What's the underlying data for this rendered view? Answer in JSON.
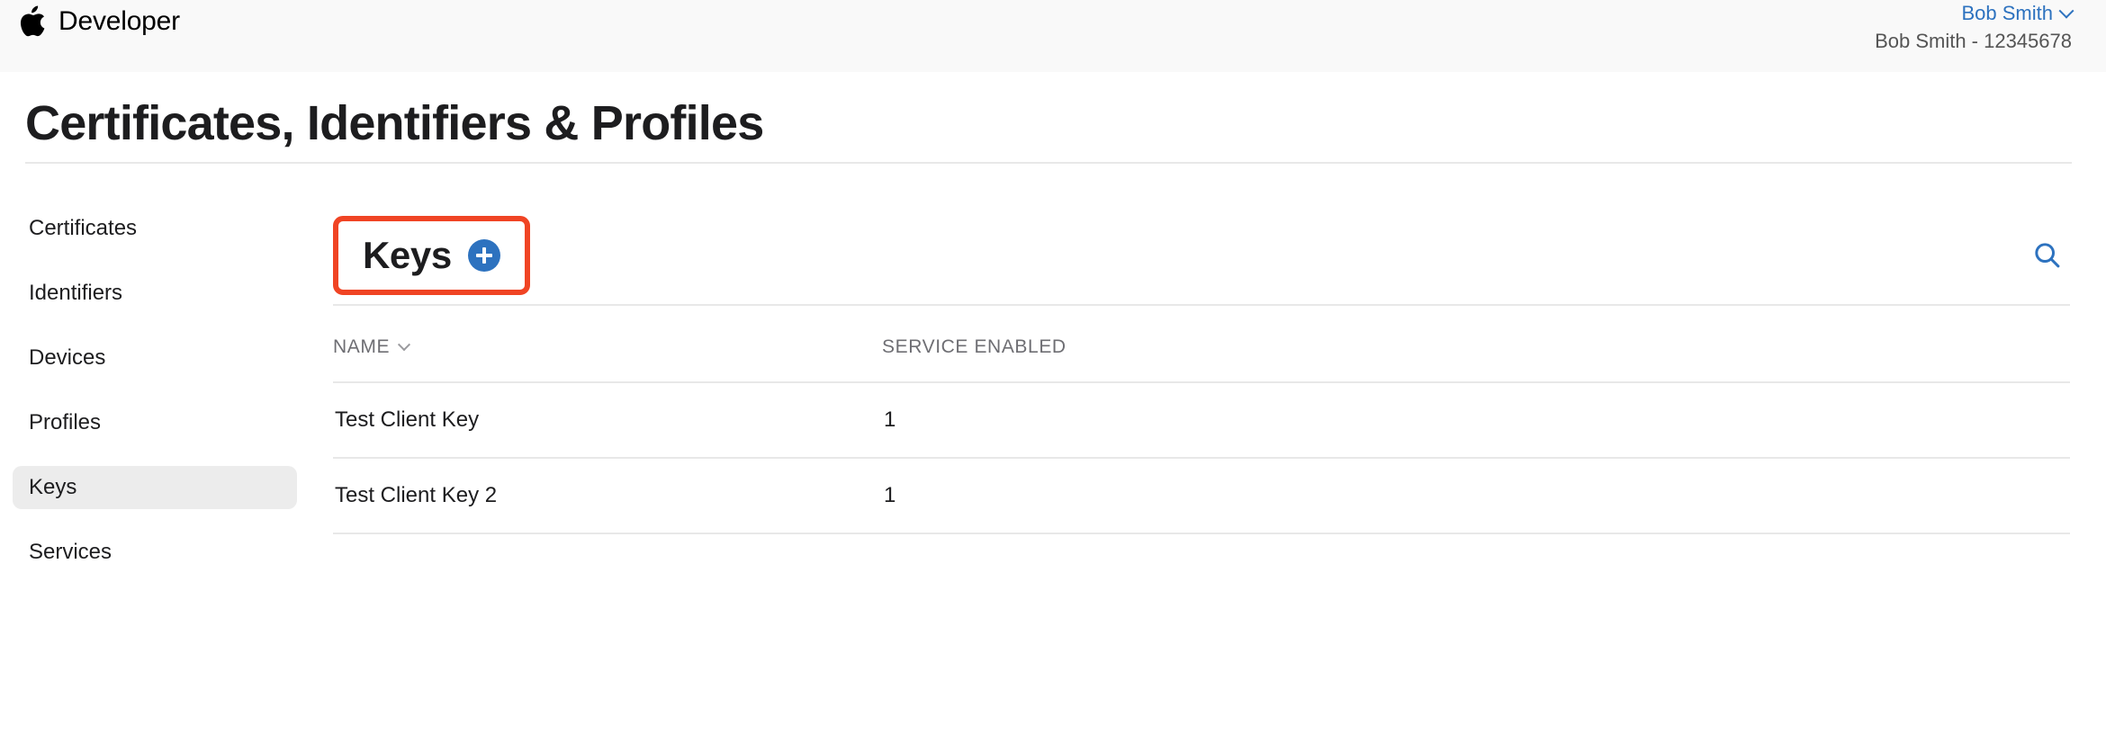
{
  "globalnav": {
    "logo_icon": "apple-logo-icon",
    "brand": "Developer",
    "account_name": "Bob Smith",
    "account_chevron_icon": "chevron-down-icon",
    "account_team": "Bob Smith - 12345678"
  },
  "page": {
    "title": "Certificates, Identifiers & Profiles"
  },
  "sidebar": {
    "items": [
      {
        "label": "Certificates",
        "active": false
      },
      {
        "label": "Identifiers",
        "active": false
      },
      {
        "label": "Devices",
        "active": false
      },
      {
        "label": "Profiles",
        "active": false
      },
      {
        "label": "Keys",
        "active": true
      },
      {
        "label": "Services",
        "active": false
      }
    ]
  },
  "content": {
    "section_title": "Keys",
    "add_button_label": "+",
    "add_button_icon": "plus-circle-icon",
    "search_icon": "search-icon",
    "highlight_color": "#f04424",
    "accent_color": "#2d72bf"
  },
  "table": {
    "columns": [
      {
        "label": "NAME",
        "sortable": true,
        "sort_icon": "chevron-down-icon"
      },
      {
        "label": "SERVICE ENABLED",
        "sortable": false
      }
    ],
    "rows": [
      {
        "name": "Test Client Key",
        "service_enabled": "1"
      },
      {
        "name": "Test Client Key 2",
        "service_enabled": "1"
      }
    ]
  }
}
